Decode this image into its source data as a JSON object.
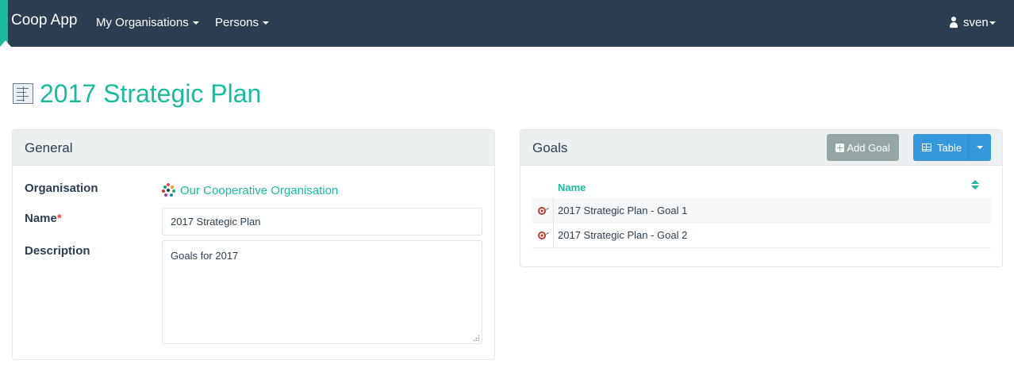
{
  "navbar": {
    "brand": "Coop App",
    "menu": [
      {
        "label": "My Organisations"
      },
      {
        "label": "Persons"
      }
    ],
    "user": "sven"
  },
  "page": {
    "title": "2017 Strategic Plan"
  },
  "general": {
    "heading": "General",
    "organisation_label": "Organisation",
    "organisation_value": "Our Cooperative Organisation",
    "name_label": "Name",
    "name_required_mark": "*",
    "name_value": "2017 Strategic Plan",
    "description_label": "Description",
    "description_value": "Goals for 2017"
  },
  "goals": {
    "heading": "Goals",
    "add_button": "Add Goal",
    "view_button": "Table",
    "column_name": "Name",
    "rows": [
      {
        "name": "2017 Strategic Plan - Goal 1"
      },
      {
        "name": "2017 Strategic Plan - Goal 2"
      }
    ]
  },
  "icons": {
    "title_icon": "strategic-plan-icon",
    "org_icon": "cooperative-logo-icon",
    "row_icon": "target-icon",
    "user_icon": "user-icon"
  },
  "colors": {
    "navbar": "#2c3e50",
    "accent": "#18bc9c",
    "primary_button": "#3498db",
    "secondary_button": "#95a5a6",
    "required": "#e74c3c"
  }
}
